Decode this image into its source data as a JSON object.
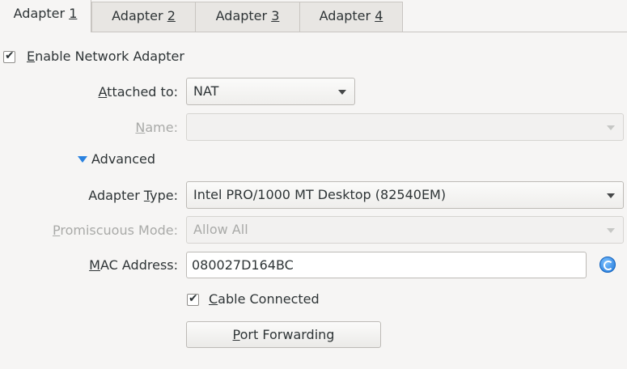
{
  "tabs": [
    {
      "pre": "Adapter ",
      "mn": "1",
      "post": ""
    },
    {
      "pre": "Adapter ",
      "mn": "2",
      "post": ""
    },
    {
      "pre": "Adapter ",
      "mn": "3",
      "post": ""
    },
    {
      "pre": "Adapter ",
      "mn": "4",
      "post": ""
    }
  ],
  "enable": {
    "checked": true,
    "mn": "E",
    "rest": "nable Network Adapter"
  },
  "attached": {
    "pre": "",
    "mn": "A",
    "post": "ttached to:",
    "value": "NAT"
  },
  "name": {
    "pre": "",
    "mn": "N",
    "post": "ame:",
    "value": ""
  },
  "advanced": {
    "pre": "A",
    "mn": "d",
    "post": "vanced"
  },
  "adapter_type": {
    "pre": "Adapter ",
    "mn": "T",
    "post": "ype:",
    "value": "Intel PRO/1000 MT Desktop (82540EM)"
  },
  "promiscuous": {
    "pre": "",
    "mn": "P",
    "post": "romiscuous Mode:",
    "value": "Allow All"
  },
  "mac": {
    "pre": "",
    "mn": "M",
    "post": "AC Address:",
    "value": "080027D164BC",
    "refresh_icon": "refresh-icon"
  },
  "cable": {
    "checked": true,
    "mn": "C",
    "rest": "able Connected"
  },
  "port_forwarding": {
    "mn": "P",
    "rest": "ort Forwarding"
  },
  "colors": {
    "accent": "#2a82e0",
    "disabled_text": "#a9aaa8",
    "background": "#f6f5f4"
  }
}
